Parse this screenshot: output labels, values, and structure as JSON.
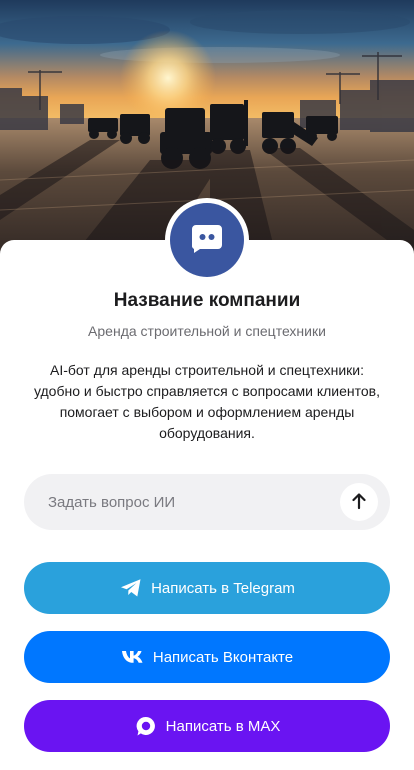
{
  "company": {
    "name": "Название компании",
    "subtitle": "Аренда строительной и спецтехники",
    "description": "AI-бот для аренды строительной и спецтехники: удобно и быстро справляется с вопросами клиентов, помогает с выбором и оформлением аренды оборудования."
  },
  "hero": {
    "image_icon": "construction-equipment-sunset-photo"
  },
  "avatar": {
    "icon": "chat-bot-icon",
    "color": "#3a56a0"
  },
  "ask": {
    "placeholder": "Задать вопрос ИИ",
    "send_icon": "arrow-up-icon"
  },
  "buttons": {
    "telegram": {
      "label": "Написать в Telegram",
      "icon": "telegram-icon",
      "color": "#2aa1dc"
    },
    "vk": {
      "label": "Написать Вконтакте",
      "icon": "vk-icon",
      "color": "#0077ff"
    },
    "max": {
      "label": "Написать в MAX",
      "icon": "max-icon",
      "color": "#6a14f2"
    }
  }
}
